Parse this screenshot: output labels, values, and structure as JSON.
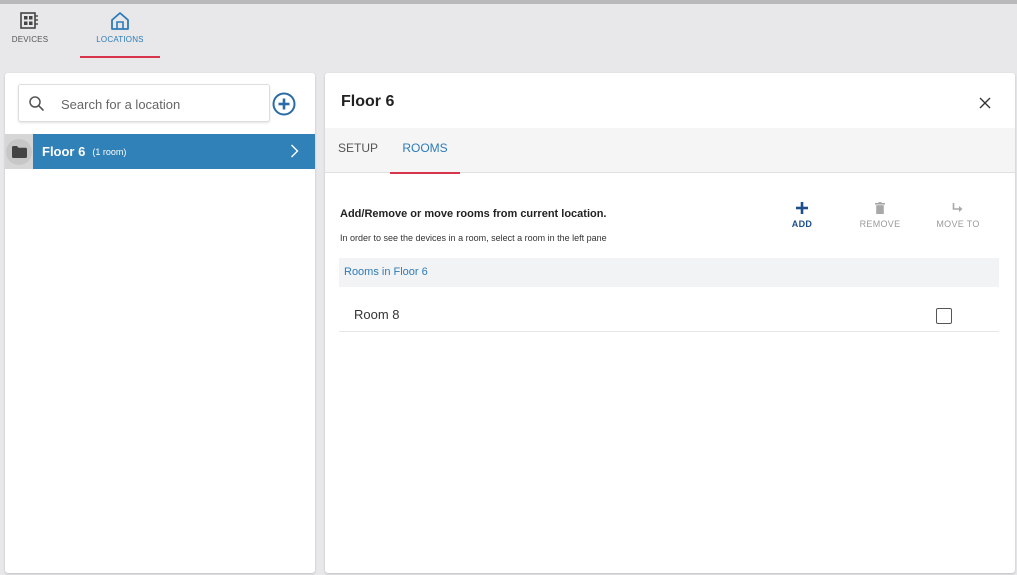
{
  "nav": {
    "devices_label": "DEVICES",
    "locations_label": "LOCATIONS"
  },
  "left": {
    "search_placeholder": "Search for a location",
    "location": {
      "name": "Floor 6",
      "count": "(1 room)"
    }
  },
  "right": {
    "title": "Floor 6",
    "tabs": [
      {
        "label": "SETUP"
      },
      {
        "label": "ROOMS"
      }
    ],
    "description_title": "Add/Remove or move rooms from current location.",
    "description_sub": "In order to see the devices in a room, select a room in the left pane",
    "actions": {
      "add": "ADD",
      "remove": "REMOVE",
      "move_to": "MOVE TO"
    },
    "rooms_header": "Rooms in Floor 6",
    "rooms": [
      {
        "name": "Room 8"
      }
    ]
  },
  "colors": {
    "accent_blue": "#3181b9",
    "tab_underline": "#d8344b"
  }
}
